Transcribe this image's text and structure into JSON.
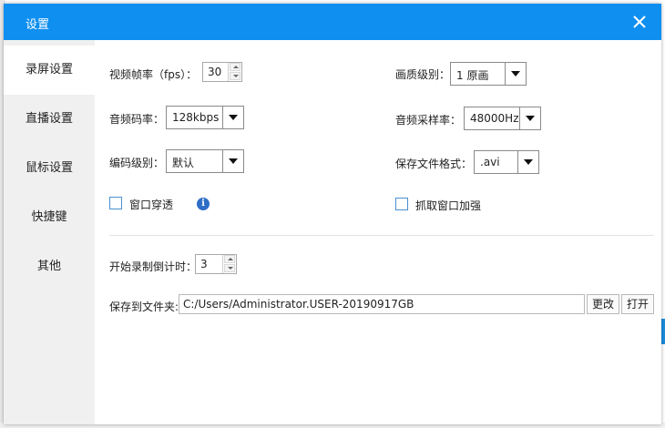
{
  "window": {
    "title": "设置"
  },
  "sidebar": {
    "items": [
      {
        "label": "录屏设置",
        "active": true
      },
      {
        "label": "直播设置",
        "active": false
      },
      {
        "label": "鼠标设置",
        "active": false
      },
      {
        "label": "快捷键",
        "active": false
      },
      {
        "label": "其他",
        "active": false
      }
    ]
  },
  "settings": {
    "fps": {
      "label": "视频帧率（fps）：",
      "value": "30"
    },
    "quality": {
      "label": "画质级别：",
      "value": "1 原画"
    },
    "audio_bitrate": {
      "label": "音频码率：",
      "value": "128kbps"
    },
    "sample_rate": {
      "label": "音频采样率：",
      "value": "48000Hz"
    },
    "encode_level": {
      "label": "编码级别：",
      "value": "默认"
    },
    "file_format": {
      "label": "保存文件格式：",
      "value": ".avi"
    },
    "window_through": {
      "label": "窗口穿透",
      "checked": false
    },
    "capture_enhance": {
      "label": "抓取窗口加强",
      "checked": false
    },
    "countdown": {
      "label": "开始录制倒计时：",
      "value": "3"
    },
    "save_folder": {
      "label": "保存到文件夹:",
      "value": "C:/Users/Administrator.USER-20190917GB"
    }
  },
  "buttons": {
    "change": "更改",
    "open": "打开"
  },
  "icons": {
    "close": "close-icon",
    "info": "info-icon",
    "info_glyph": "i"
  },
  "colors": {
    "titlebar": "#0f8ff0",
    "sidebar": "#f0f0f0",
    "checkbox_border": "#4a8fd0"
  }
}
